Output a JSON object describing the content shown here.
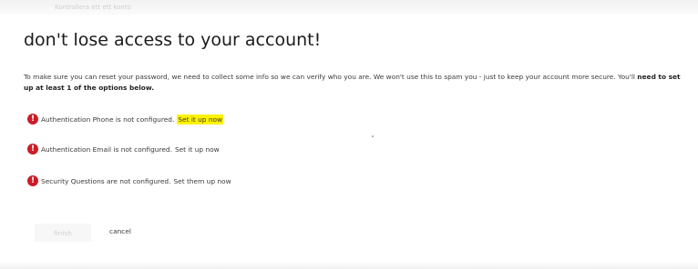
{
  "header": {
    "faint_text": "Kontrollera ett ett konto"
  },
  "page": {
    "title": "don't lose access to your account!",
    "intro_text": "To make sure you can reset your password, we need to collect some info so we can verify who you are. We won't use this to spam you - just to keep your account more secure. You'll ",
    "intro_emphasis": "need to set up at least 1 of the options below."
  },
  "items": [
    {
      "icon": "error-icon",
      "text": "Authentication Phone is not configured.",
      "link": "Set it up now"
    },
    {
      "icon": "error-icon",
      "text": "Authentication Email is not configured.",
      "link": "Set it up now"
    },
    {
      "icon": "error-icon",
      "text": "Security Questions are not configured.",
      "link": "Set them up now"
    }
  ],
  "footer": {
    "next_label": "finish",
    "cancel_label": "cancel"
  },
  "colors": {
    "error": "#cc1c27",
    "highlight": "#fff200"
  }
}
